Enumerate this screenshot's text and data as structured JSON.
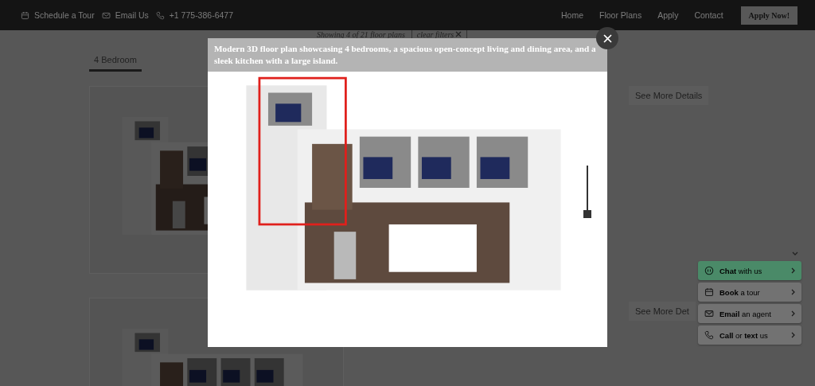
{
  "header": {
    "contacts": [
      {
        "kind": "calendar",
        "label": "Schedule a Tour"
      },
      {
        "kind": "mail",
        "label": "Email Us"
      },
      {
        "kind": "phone",
        "label": "+1 775-386-6477"
      }
    ],
    "nav": [
      "Home",
      "Floor Plans",
      "Apply",
      "Contact"
    ],
    "cta": "Apply Now!"
  },
  "filters": {
    "summary": "Showing 4 of 21 floor plans",
    "clear": "clear filters"
  },
  "tabs": [
    {
      "label": "4 Bedroom",
      "selected": true
    }
  ],
  "cards": [
    {
      "kind": "picture",
      "button": "See More Details"
    },
    {
      "kind": "picture",
      "button": "See More Det"
    }
  ],
  "modal": {
    "caption": "Modern 3D floor plan showcasing 4 bedrooms, a spacious open-concept living and dining area, and a sleek kitchen with a large island.",
    "slider": {
      "level": 0
    }
  },
  "chat": {
    "items": [
      {
        "kind": "chat",
        "label": "**Chat** with us",
        "selected": true
      },
      {
        "kind": "calendar",
        "label": "**Book** a tour",
        "selected": false
      },
      {
        "kind": "mail",
        "label": "**Email** an agent",
        "selected": false
      },
      {
        "kind": "phone",
        "label": "**Call** or **text** us",
        "selected": false
      }
    ]
  }
}
